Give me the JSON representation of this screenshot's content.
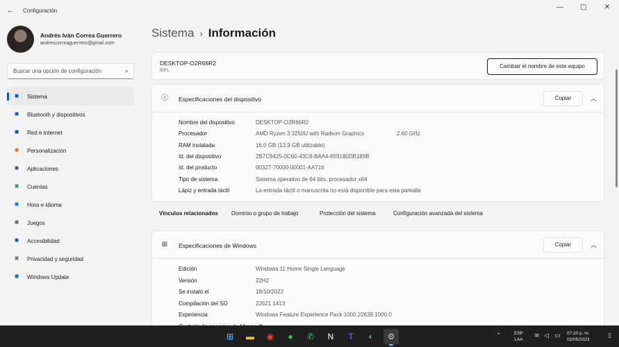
{
  "window": {
    "app_title": "Configuración",
    "controls": {
      "minimize": "—",
      "maximize": "▢",
      "close": "✕"
    }
  },
  "profile": {
    "name": "Andrés Iván Correa Guerrero",
    "email": "andrescorreaguerrero@gmail.com"
  },
  "search": {
    "placeholder": "Buscar una opción de configuración"
  },
  "sidebar": {
    "items": [
      {
        "label": "Sistema",
        "icon": "monitor-icon",
        "color": "#0067c0",
        "active": true
      },
      {
        "label": "Bluetooth y dispositivos",
        "icon": "bluetooth-icon",
        "color": "#0067c0"
      },
      {
        "label": "Red e Internet",
        "icon": "wifi-icon",
        "color": "#1a4f9c"
      },
      {
        "label": "Personalización",
        "icon": "brush-icon",
        "color": "#d9822b"
      },
      {
        "label": "Aplicaciones",
        "icon": "apps-icon",
        "color": "#505b73"
      },
      {
        "label": "Cuentas",
        "icon": "person-icon",
        "color": "#27a36a"
      },
      {
        "label": "Hora e idioma",
        "icon": "globe-clock-icon",
        "color": "#1b7fd6"
      },
      {
        "label": "Juegos",
        "icon": "gamepad-icon",
        "color": "#6b6b6b"
      },
      {
        "label": "Accesibilidad",
        "icon": "accessibility-icon",
        "color": "#1b5fa8"
      },
      {
        "label": "Privacidad y seguridad",
        "icon": "shield-icon",
        "color": "#6f7888"
      },
      {
        "label": "Windows Update",
        "icon": "update-icon",
        "color": "#0a6cc2"
      }
    ]
  },
  "breadcrumb": {
    "parent": "Sistema",
    "separator": "›",
    "current": "Información"
  },
  "device": {
    "name": "DESKTOP-O2R66R2",
    "model": "82FL",
    "rename_label": "Cambiar el nombre de este equipo"
  },
  "device_specs": {
    "title": "Especificaciones del dispositivo",
    "copy_label": "Copiar",
    "rows": [
      {
        "label": "Nombre del dispositivo",
        "value": "DESKTOP-O2R66R2",
        "extra": ""
      },
      {
        "label": "Procesador",
        "value": "AMD Ryzen 3 3250U with Radeon Graphics",
        "extra": "2.60 GHz"
      },
      {
        "label": "RAM instalada",
        "value": "16.0 GB (13.9 GB utilizable)",
        "extra": ""
      },
      {
        "label": "Id. del dispositivo",
        "value": "2B7C9425-0C60-43C8-BAA4-659180DB189B",
        "extra": ""
      },
      {
        "label": "Id. del producto",
        "value": "00327-70000-00001-AA716",
        "extra": ""
      },
      {
        "label": "Tipo de sistema",
        "value": "Sistema operativo de 64 bits, procesador x64",
        "extra": ""
      },
      {
        "label": "Lápiz y entrada táctil",
        "value": "La entrada táctil o manuscrita no está disponible para esta pantalla",
        "extra": ""
      }
    ]
  },
  "related_links": {
    "title": "Vínculos relacionados",
    "links": [
      "Dominio o grupo de trabajo",
      "Protección del sistema",
      "Configuración avanzada del sistema"
    ]
  },
  "windows_specs": {
    "title": "Especificaciones de Windows",
    "copy_label": "Copiar",
    "rows": [
      {
        "label": "Edición",
        "value": "Windows 11 Home Single Language"
      },
      {
        "label": "Versión",
        "value": "22H2"
      },
      {
        "label": "Se instaló el",
        "value": "18/10/2022"
      },
      {
        "label": "Compilación del SO",
        "value": "22621.1413"
      },
      {
        "label": "Experiencia",
        "value": "Windows Feature Experience Pack 1000.22639.1000.0"
      },
      {
        "label": "Contrato de servicios de Microsoft",
        "value": ""
      }
    ]
  },
  "taskbar": {
    "apps": [
      {
        "name": "windows-start-icon",
        "glyph": "⊞",
        "color": "#4cc2ff"
      },
      {
        "name": "file-explorer-icon",
        "glyph": "▬",
        "color": "#f4c542"
      },
      {
        "name": "chrome-icon",
        "glyph": "◉",
        "color": "#e94235"
      },
      {
        "name": "spotify-icon",
        "glyph": "●",
        "color": "#1ed760"
      },
      {
        "name": "whatsapp-icon",
        "glyph": "✆",
        "color": "#25d366"
      },
      {
        "name": "notion-icon",
        "glyph": "N",
        "color": "#ffffff"
      },
      {
        "name": "teams-icon",
        "glyph": "T",
        "color": "#7b83eb"
      },
      {
        "name": "clipchamp-icon",
        "glyph": "◐",
        "color": "#50b848"
      },
      {
        "name": "settings-icon",
        "glyph": "⚙",
        "color": "#c8c8c8"
      }
    ],
    "language": {
      "line1": "ESP",
      "line2": "LAA"
    },
    "clock": {
      "time": "07:20 p. m.",
      "date": "02/05/2023"
    }
  }
}
